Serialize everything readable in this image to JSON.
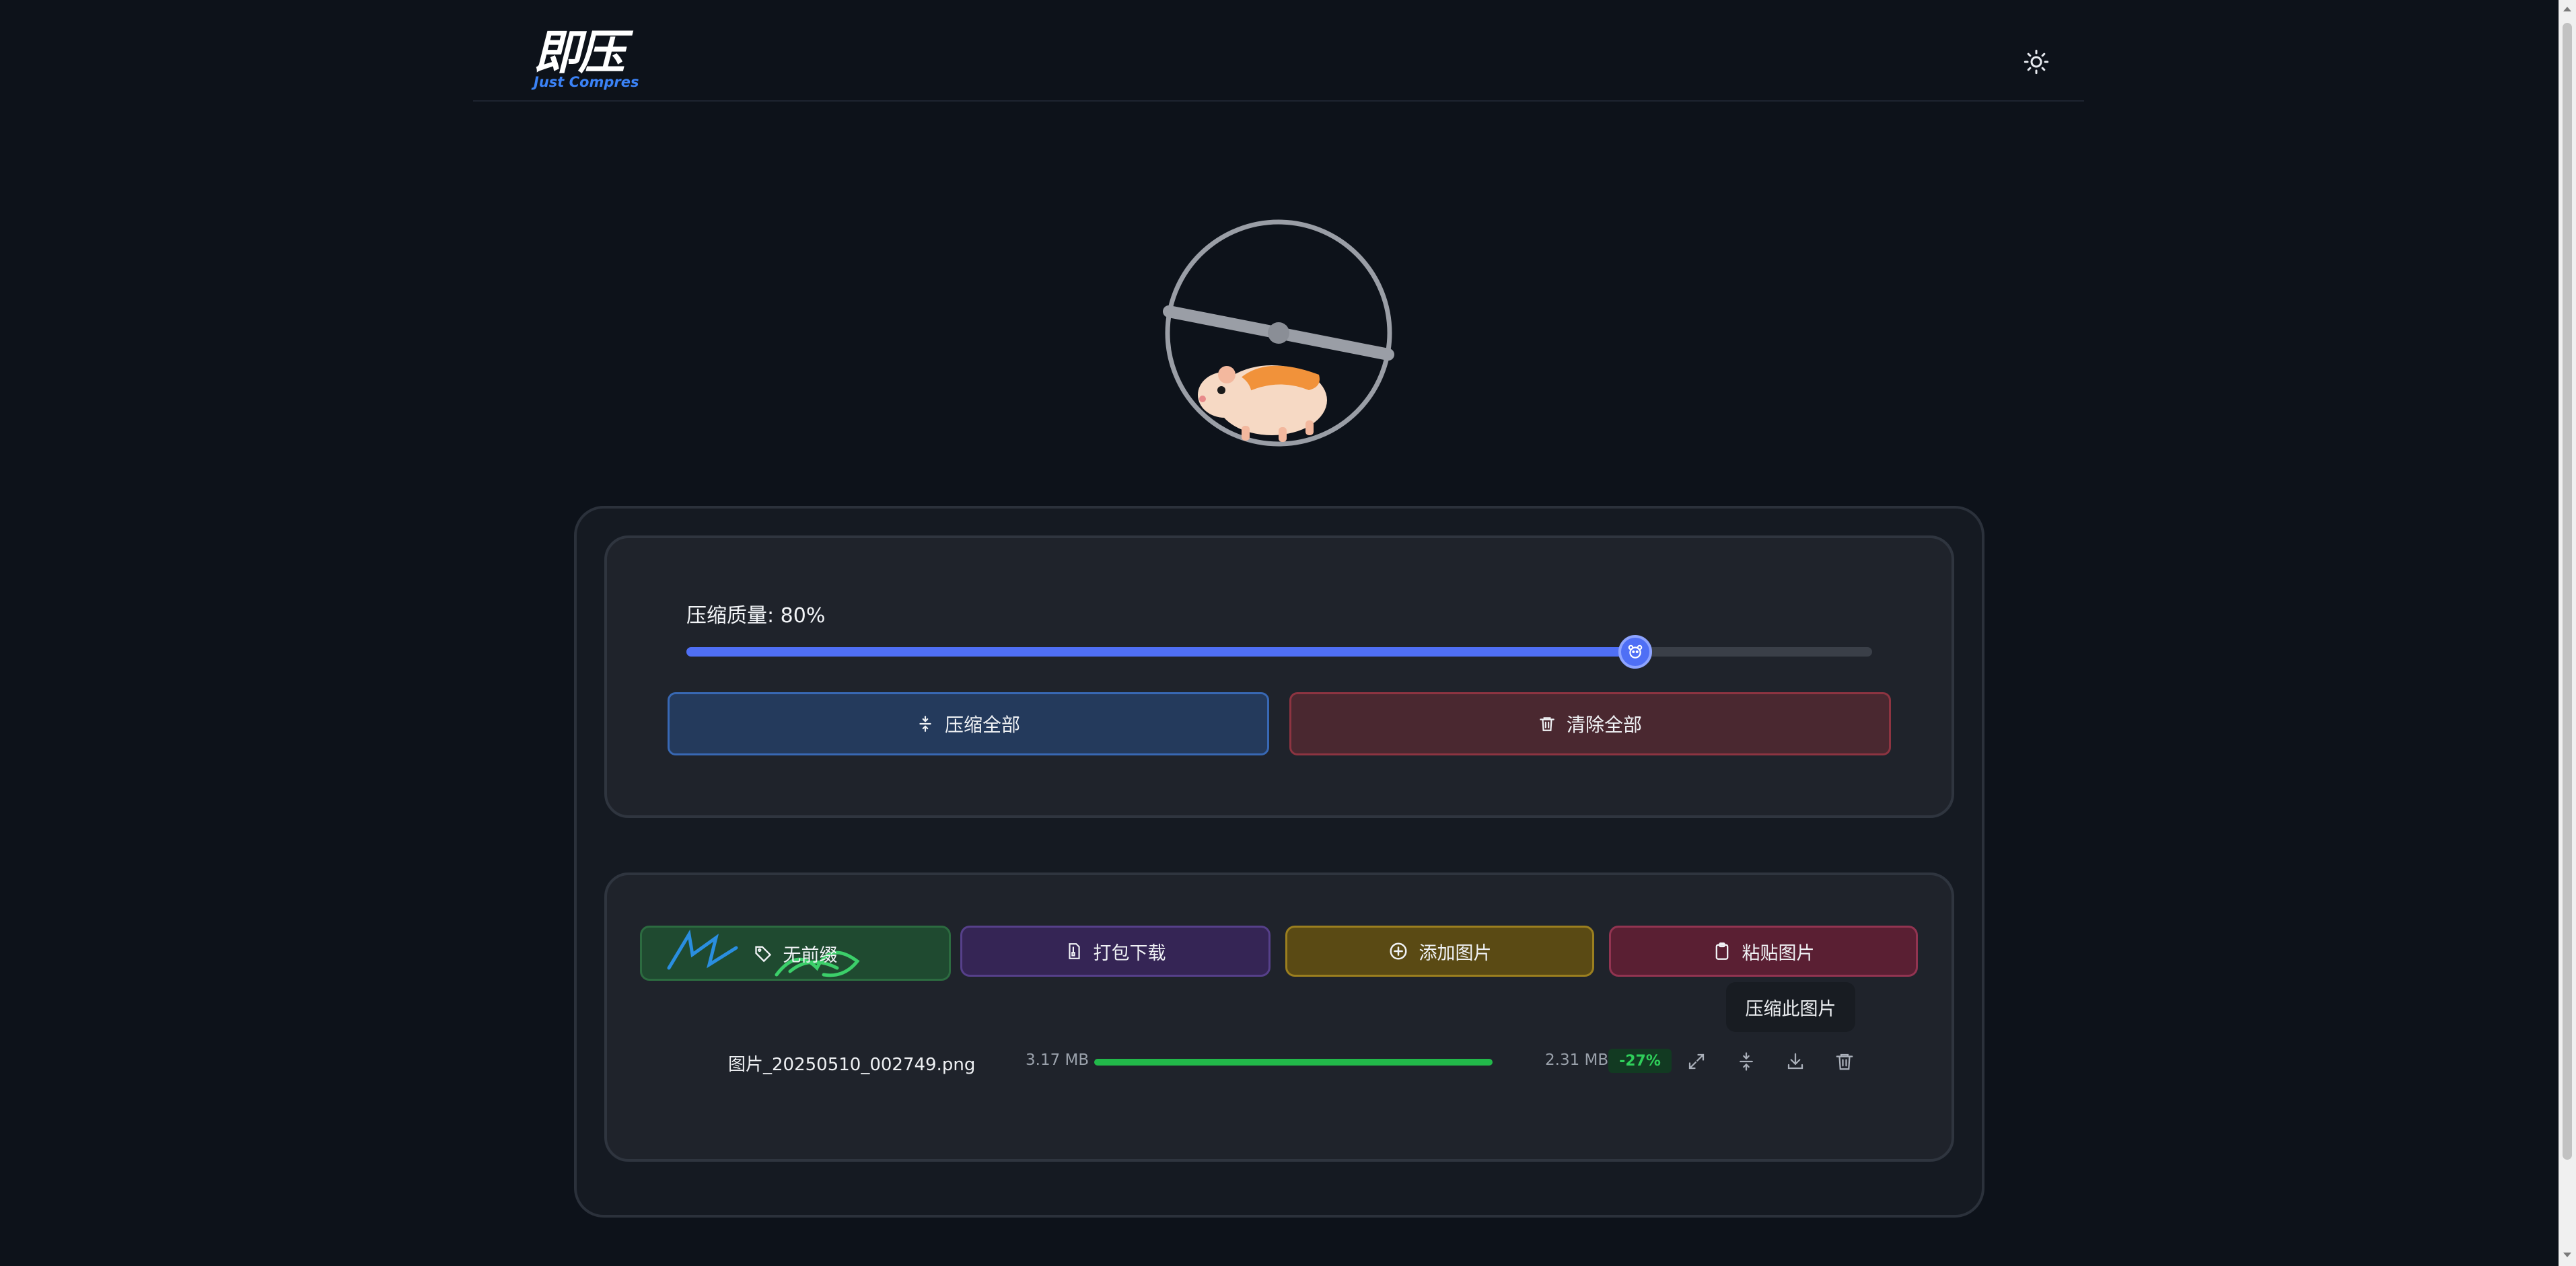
{
  "header": {
    "logo_cn": "即压",
    "logo_en": "Just Compres",
    "theme_toggle_icon": "sun-icon"
  },
  "compression": {
    "quality_label": "压缩质量: 80%",
    "quality_value": 80,
    "compress_all_label": "压缩全部",
    "clear_all_label": "清除全部"
  },
  "toolbar": {
    "no_prefix_label": "无前缀",
    "bundle_download_label": "打包下载",
    "add_image_label": "添加图片",
    "paste_image_label": "粘贴图片"
  },
  "tooltip": {
    "text": "压缩此图片"
  },
  "files": [
    {
      "name": "图片_20250510_002749.png",
      "original_size": "3.17 MB",
      "compressed_size": "2.31 MB",
      "ratio": "-27%",
      "progress": 1.0
    }
  ],
  "colors": {
    "accent": "#4f6ff5",
    "danger": "#8d3441",
    "success": "#22b84a"
  }
}
